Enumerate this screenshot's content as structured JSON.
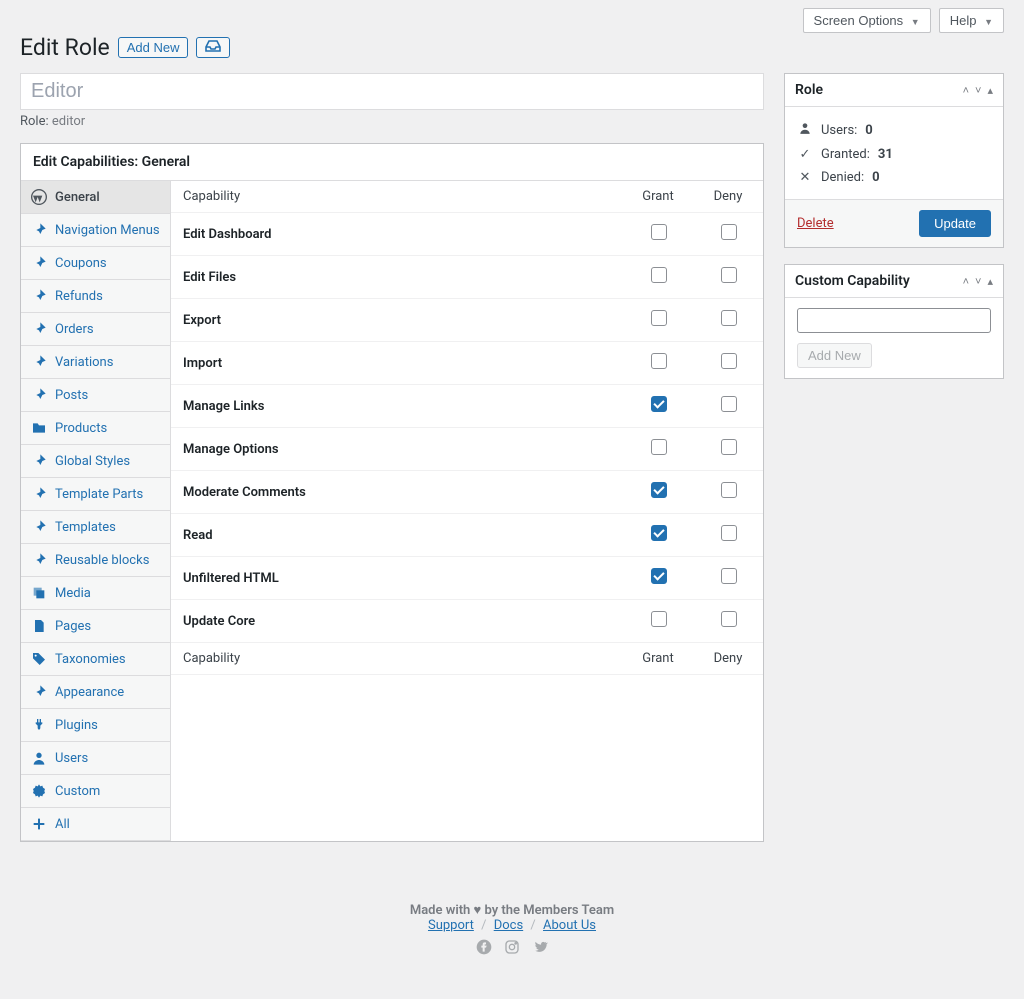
{
  "topButtons": {
    "screenOptions": "Screen Options",
    "help": "Help"
  },
  "heading": {
    "title": "Edit Role",
    "addNew": "Add New"
  },
  "roleNameInput": "Editor",
  "roleSlug": {
    "label": "Role:",
    "value": "editor"
  },
  "capBoxTitle": "Edit Capabilities: General",
  "tabs": [
    {
      "label": "General",
      "icon": "wp",
      "active": true
    },
    {
      "label": "Navigation Menus",
      "icon": "pin"
    },
    {
      "label": "Coupons",
      "icon": "pin"
    },
    {
      "label": "Refunds",
      "icon": "pin"
    },
    {
      "label": "Orders",
      "icon": "pin"
    },
    {
      "label": "Variations",
      "icon": "pin"
    },
    {
      "label": "Posts",
      "icon": "pin"
    },
    {
      "label": "Products",
      "icon": "folder"
    },
    {
      "label": "Global Styles",
      "icon": "pin"
    },
    {
      "label": "Template Parts",
      "icon": "pin"
    },
    {
      "label": "Templates",
      "icon": "pin"
    },
    {
      "label": "Reusable blocks",
      "icon": "pin"
    },
    {
      "label": "Media",
      "icon": "media"
    },
    {
      "label": "Pages",
      "icon": "page"
    },
    {
      "label": "Taxonomies",
      "icon": "tag"
    },
    {
      "label": "Appearance",
      "icon": "pin"
    },
    {
      "label": "Plugins",
      "icon": "plug"
    },
    {
      "label": "Users",
      "icon": "user"
    },
    {
      "label": "Custom",
      "icon": "gear"
    },
    {
      "label": "All",
      "icon": "plus"
    }
  ],
  "capTable": {
    "headers": {
      "cap": "Capability",
      "grant": "Grant",
      "deny": "Deny"
    },
    "rows": [
      {
        "label": "Edit Dashboard",
        "grant": false,
        "deny": false
      },
      {
        "label": "Edit Files",
        "grant": false,
        "deny": false
      },
      {
        "label": "Export",
        "grant": false,
        "deny": false
      },
      {
        "label": "Import",
        "grant": false,
        "deny": false
      },
      {
        "label": "Manage Links",
        "grant": true,
        "deny": false
      },
      {
        "label": "Manage Options",
        "grant": false,
        "deny": false
      },
      {
        "label": "Moderate Comments",
        "grant": true,
        "deny": false
      },
      {
        "label": "Read",
        "grant": true,
        "deny": false
      },
      {
        "label": "Unfiltered HTML",
        "grant": true,
        "deny": false
      },
      {
        "label": "Update Core",
        "grant": false,
        "deny": false
      }
    ]
  },
  "roleBox": {
    "title": "Role",
    "usersLabel": "Users:",
    "usersValue": "0",
    "grantedLabel": "Granted:",
    "grantedValue": "31",
    "deniedLabel": "Denied:",
    "deniedValue": "0",
    "delete": "Delete",
    "update": "Update"
  },
  "customCapBox": {
    "title": "Custom Capability",
    "addNew": "Add New"
  },
  "footer": {
    "made": "Made with ♥ by the Members Team",
    "support": "Support",
    "docs": "Docs",
    "about": "About Us"
  }
}
